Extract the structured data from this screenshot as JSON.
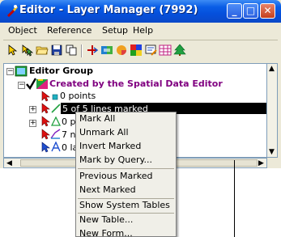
{
  "window": {
    "title": "Editor - Layer Manager (7992)",
    "caption_buttons": {
      "minimize": "_",
      "maximize": "□",
      "close": "✕"
    }
  },
  "menu": [
    "Object",
    "Reference",
    "Setup",
    "Help"
  ],
  "toolbar": {
    "icons": [
      "select-arrow-icon",
      "select-multi-icon",
      "open-folder-icon",
      "save-icon",
      "copy-layer-icon",
      "move-icon",
      "layer-color-icon",
      "paint-icon",
      "grid-icon",
      "edit-icon",
      "table-icon",
      "tree-icon"
    ]
  },
  "tree": {
    "group_label": "Editor Group",
    "layer_label": "Created by the Spatial Data Editor",
    "rows": [
      {
        "label": "0 points"
      },
      {
        "label": "5 of 5 lines marked"
      },
      {
        "label": "0 po"
      },
      {
        "label": "7 no"
      },
      {
        "label": "0 la"
      }
    ]
  },
  "context_menu": {
    "items": [
      "Mark All",
      "Unmark All",
      "Invert Marked",
      "Mark by Query...",
      "Previous Marked",
      "Next Marked",
      "Show System Tables",
      "New Table...",
      "New Form..."
    ]
  },
  "colors": {
    "titlebar": "#0550dc",
    "layer_text": "#800080",
    "selection": "#000000"
  }
}
